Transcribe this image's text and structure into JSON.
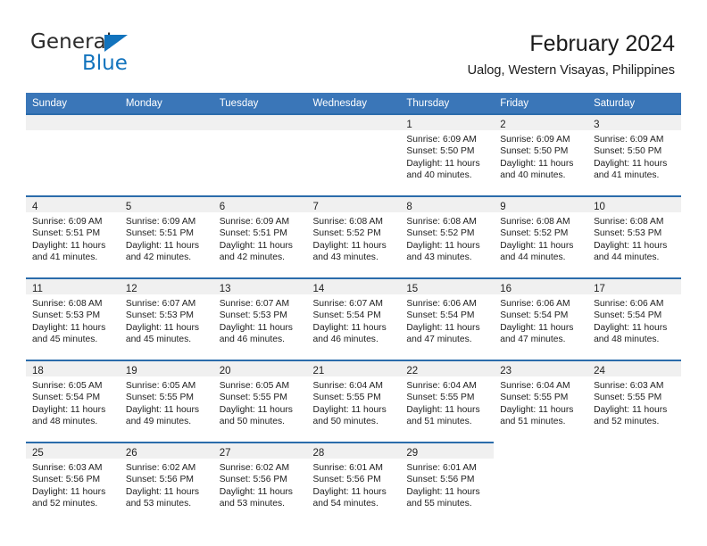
{
  "brand": {
    "name_part1": "General",
    "name_part2": "Blue",
    "triangle_color": "#1273bd",
    "text_color": "#2b2b2b"
  },
  "header": {
    "title": "February 2024",
    "subtitle": "Ualog, Western Visayas, Philippines"
  },
  "colors": {
    "header_blue": "#3a76b8",
    "row_rule_blue": "#2b6cab",
    "daynum_band": "#f0f0f0",
    "text": "#212121"
  },
  "calendar": {
    "weekday_headers": [
      "Sunday",
      "Monday",
      "Tuesday",
      "Wednesday",
      "Thursday",
      "Friday",
      "Saturday"
    ],
    "labels": {
      "sunrise": "Sunrise:",
      "sunset": "Sunset:",
      "daylight_prefix": "Daylight:"
    },
    "weeks": [
      [
        {
          "day": "",
          "empty": true
        },
        {
          "day": "",
          "empty": true
        },
        {
          "day": "",
          "empty": true
        },
        {
          "day": "",
          "empty": true
        },
        {
          "day": "1",
          "sunrise": "Sunrise: 6:09 AM",
          "sunset": "Sunset: 5:50 PM",
          "daylight_l1": "Daylight: 11 hours",
          "daylight_l2": "and 40 minutes."
        },
        {
          "day": "2",
          "sunrise": "Sunrise: 6:09 AM",
          "sunset": "Sunset: 5:50 PM",
          "daylight_l1": "Daylight: 11 hours",
          "daylight_l2": "and 40 minutes."
        },
        {
          "day": "3",
          "sunrise": "Sunrise: 6:09 AM",
          "sunset": "Sunset: 5:50 PM",
          "daylight_l1": "Daylight: 11 hours",
          "daylight_l2": "and 41 minutes."
        }
      ],
      [
        {
          "day": "4",
          "sunrise": "Sunrise: 6:09 AM",
          "sunset": "Sunset: 5:51 PM",
          "daylight_l1": "Daylight: 11 hours",
          "daylight_l2": "and 41 minutes."
        },
        {
          "day": "5",
          "sunrise": "Sunrise: 6:09 AM",
          "sunset": "Sunset: 5:51 PM",
          "daylight_l1": "Daylight: 11 hours",
          "daylight_l2": "and 42 minutes."
        },
        {
          "day": "6",
          "sunrise": "Sunrise: 6:09 AM",
          "sunset": "Sunset: 5:51 PM",
          "daylight_l1": "Daylight: 11 hours",
          "daylight_l2": "and 42 minutes."
        },
        {
          "day": "7",
          "sunrise": "Sunrise: 6:08 AM",
          "sunset": "Sunset: 5:52 PM",
          "daylight_l1": "Daylight: 11 hours",
          "daylight_l2": "and 43 minutes."
        },
        {
          "day": "8",
          "sunrise": "Sunrise: 6:08 AM",
          "sunset": "Sunset: 5:52 PM",
          "daylight_l1": "Daylight: 11 hours",
          "daylight_l2": "and 43 minutes."
        },
        {
          "day": "9",
          "sunrise": "Sunrise: 6:08 AM",
          "sunset": "Sunset: 5:52 PM",
          "daylight_l1": "Daylight: 11 hours",
          "daylight_l2": "and 44 minutes."
        },
        {
          "day": "10",
          "sunrise": "Sunrise: 6:08 AM",
          "sunset": "Sunset: 5:53 PM",
          "daylight_l1": "Daylight: 11 hours",
          "daylight_l2": "and 44 minutes."
        }
      ],
      [
        {
          "day": "11",
          "sunrise": "Sunrise: 6:08 AM",
          "sunset": "Sunset: 5:53 PM",
          "daylight_l1": "Daylight: 11 hours",
          "daylight_l2": "and 45 minutes."
        },
        {
          "day": "12",
          "sunrise": "Sunrise: 6:07 AM",
          "sunset": "Sunset: 5:53 PM",
          "daylight_l1": "Daylight: 11 hours",
          "daylight_l2": "and 45 minutes."
        },
        {
          "day": "13",
          "sunrise": "Sunrise: 6:07 AM",
          "sunset": "Sunset: 5:53 PM",
          "daylight_l1": "Daylight: 11 hours",
          "daylight_l2": "and 46 minutes."
        },
        {
          "day": "14",
          "sunrise": "Sunrise: 6:07 AM",
          "sunset": "Sunset: 5:54 PM",
          "daylight_l1": "Daylight: 11 hours",
          "daylight_l2": "and 46 minutes."
        },
        {
          "day": "15",
          "sunrise": "Sunrise: 6:06 AM",
          "sunset": "Sunset: 5:54 PM",
          "daylight_l1": "Daylight: 11 hours",
          "daylight_l2": "and 47 minutes."
        },
        {
          "day": "16",
          "sunrise": "Sunrise: 6:06 AM",
          "sunset": "Sunset: 5:54 PM",
          "daylight_l1": "Daylight: 11 hours",
          "daylight_l2": "and 47 minutes."
        },
        {
          "day": "17",
          "sunrise": "Sunrise: 6:06 AM",
          "sunset": "Sunset: 5:54 PM",
          "daylight_l1": "Daylight: 11 hours",
          "daylight_l2": "and 48 minutes."
        }
      ],
      [
        {
          "day": "18",
          "sunrise": "Sunrise: 6:05 AM",
          "sunset": "Sunset: 5:54 PM",
          "daylight_l1": "Daylight: 11 hours",
          "daylight_l2": "and 48 minutes."
        },
        {
          "day": "19",
          "sunrise": "Sunrise: 6:05 AM",
          "sunset": "Sunset: 5:55 PM",
          "daylight_l1": "Daylight: 11 hours",
          "daylight_l2": "and 49 minutes."
        },
        {
          "day": "20",
          "sunrise": "Sunrise: 6:05 AM",
          "sunset": "Sunset: 5:55 PM",
          "daylight_l1": "Daylight: 11 hours",
          "daylight_l2": "and 50 minutes."
        },
        {
          "day": "21",
          "sunrise": "Sunrise: 6:04 AM",
          "sunset": "Sunset: 5:55 PM",
          "daylight_l1": "Daylight: 11 hours",
          "daylight_l2": "and 50 minutes."
        },
        {
          "day": "22",
          "sunrise": "Sunrise: 6:04 AM",
          "sunset": "Sunset: 5:55 PM",
          "daylight_l1": "Daylight: 11 hours",
          "daylight_l2": "and 51 minutes."
        },
        {
          "day": "23",
          "sunrise": "Sunrise: 6:04 AM",
          "sunset": "Sunset: 5:55 PM",
          "daylight_l1": "Daylight: 11 hours",
          "daylight_l2": "and 51 minutes."
        },
        {
          "day": "24",
          "sunrise": "Sunrise: 6:03 AM",
          "sunset": "Sunset: 5:55 PM",
          "daylight_l1": "Daylight: 11 hours",
          "daylight_l2": "and 52 minutes."
        }
      ],
      [
        {
          "day": "25",
          "sunrise": "Sunrise: 6:03 AM",
          "sunset": "Sunset: 5:56 PM",
          "daylight_l1": "Daylight: 11 hours",
          "daylight_l2": "and 52 minutes."
        },
        {
          "day": "26",
          "sunrise": "Sunrise: 6:02 AM",
          "sunset": "Sunset: 5:56 PM",
          "daylight_l1": "Daylight: 11 hours",
          "daylight_l2": "and 53 minutes."
        },
        {
          "day": "27",
          "sunrise": "Sunrise: 6:02 AM",
          "sunset": "Sunset: 5:56 PM",
          "daylight_l1": "Daylight: 11 hours",
          "daylight_l2": "and 53 minutes."
        },
        {
          "day": "28",
          "sunrise": "Sunrise: 6:01 AM",
          "sunset": "Sunset: 5:56 PM",
          "daylight_l1": "Daylight: 11 hours",
          "daylight_l2": "and 54 minutes."
        },
        {
          "day": "29",
          "sunrise": "Sunrise: 6:01 AM",
          "sunset": "Sunset: 5:56 PM",
          "daylight_l1": "Daylight: 11 hours",
          "daylight_l2": "and 55 minutes."
        },
        {
          "day": "",
          "blank": true
        },
        {
          "day": "",
          "blank": true
        }
      ]
    ]
  }
}
